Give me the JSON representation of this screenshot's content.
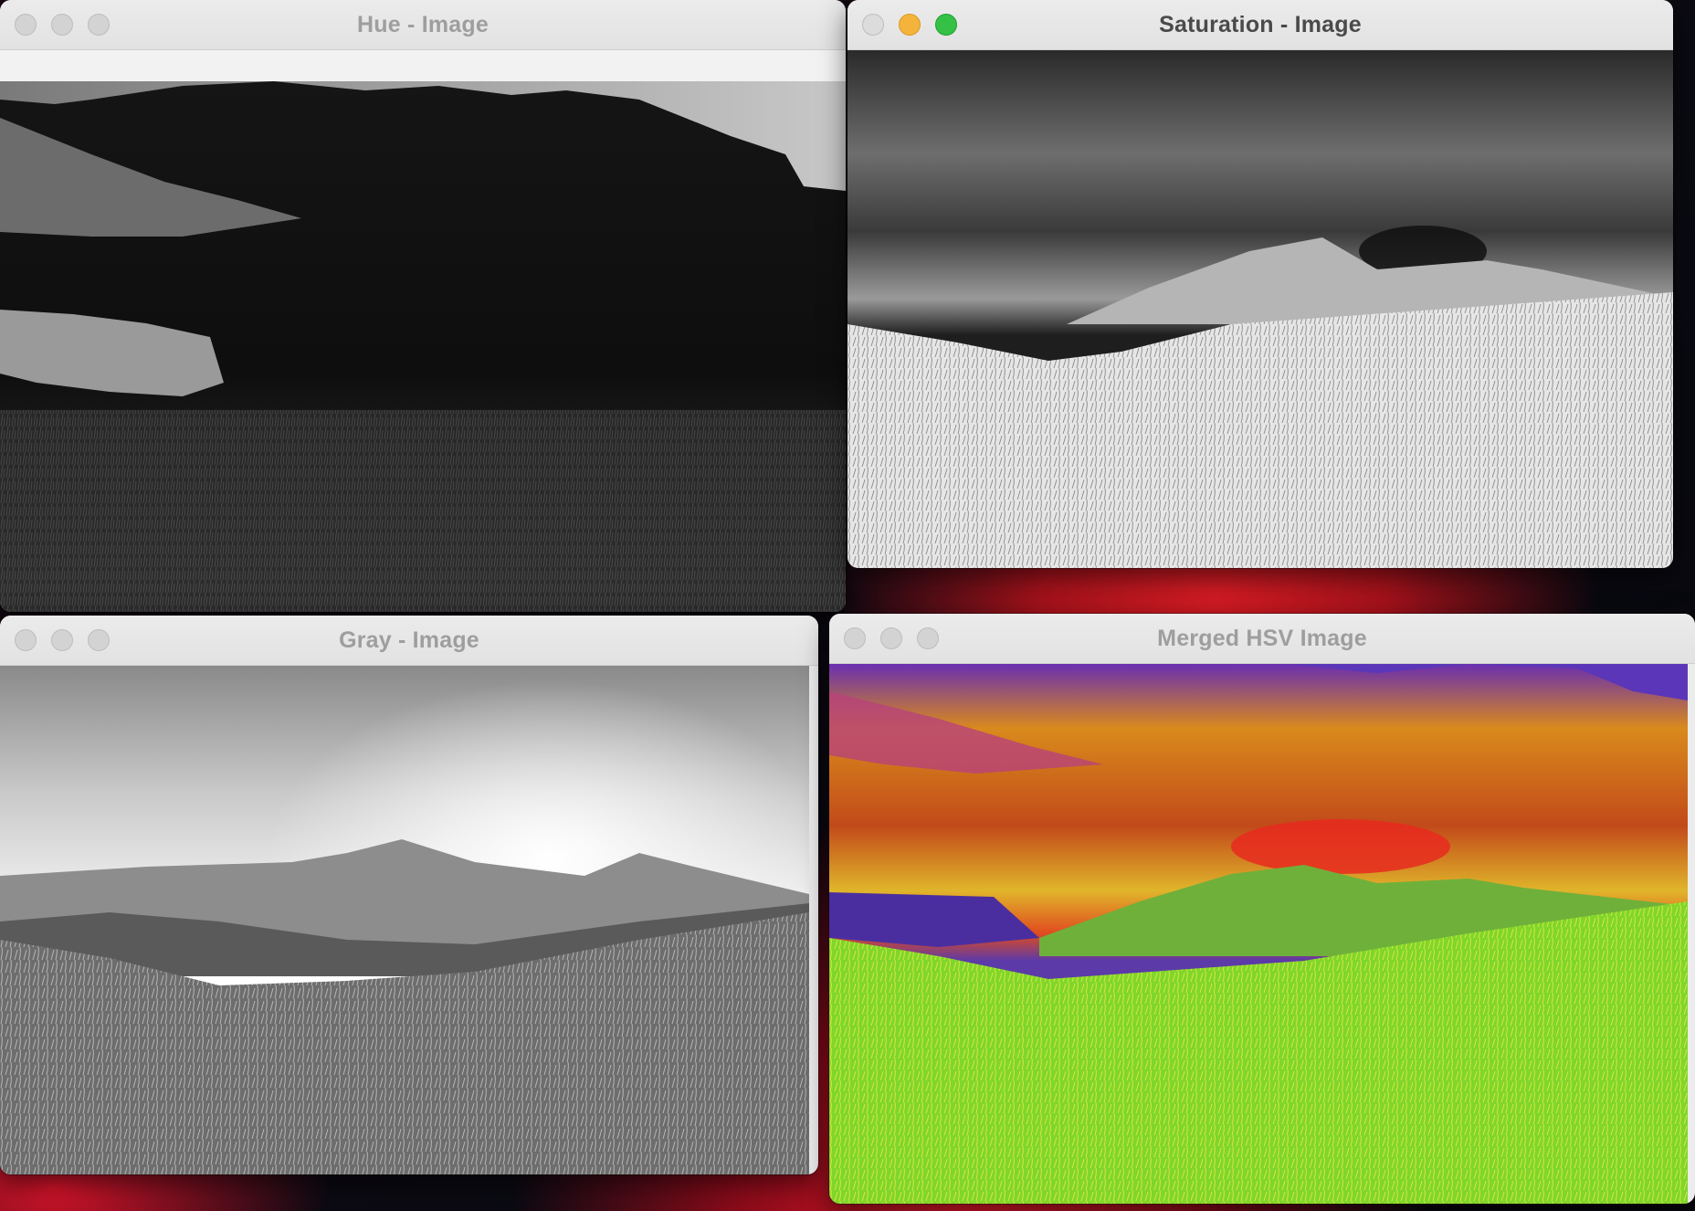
{
  "windows": {
    "hue": {
      "title": "Hue - Image"
    },
    "saturation": {
      "title": "Saturation - Image"
    },
    "gray": {
      "title": "Gray - Image"
    },
    "merged": {
      "title": "Merged HSV Image"
    }
  },
  "icons": [
    "close-icon",
    "minimize-icon",
    "zoom-icon"
  ],
  "colors": {
    "close_active": "#dcdcdc",
    "minimize_active": "#f4b43b",
    "zoom_active": "#34c145",
    "inactive": "#d3d3d3"
  }
}
